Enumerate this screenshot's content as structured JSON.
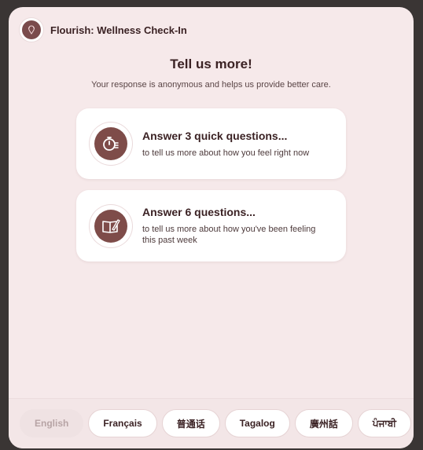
{
  "app": {
    "title": "Flourish: Wellness Check-In"
  },
  "main": {
    "title": "Tell us more!",
    "subtitle": "Your response is anonymous and helps us provide better care."
  },
  "options": [
    {
      "heading": "Answer 3 quick questions...",
      "description": "to tell us more about how you feel right now",
      "icon": "stopwatch-icon"
    },
    {
      "heading": "Answer 6 questions...",
      "description": "to tell us more about how you've been feeling this past week",
      "icon": "journal-icon"
    }
  ],
  "languages": {
    "selected": "English",
    "items": [
      "English",
      "Français",
      "普通话",
      "Tagalog",
      "廣州話",
      "ਪੰਜਾਬੀ"
    ]
  },
  "colors": {
    "background": "#f6e9ea",
    "accent": "#7e4c49",
    "text": "#3b2224"
  }
}
